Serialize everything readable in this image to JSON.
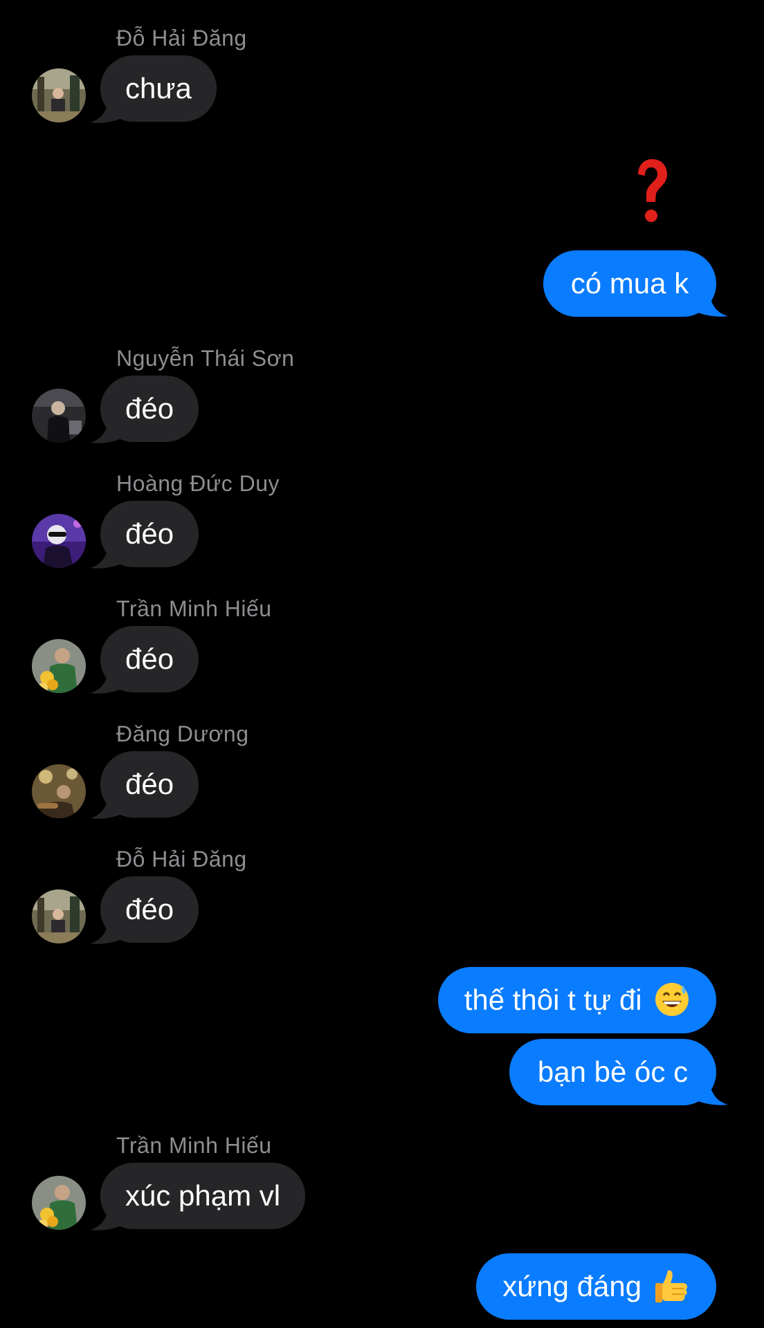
{
  "colors": {
    "background": "#000000",
    "incoming_bubble": "#262628",
    "outgoing_bubble": "#0a7cff",
    "sender_name": "#8e8e93",
    "reaction": "#e0201b"
  },
  "messages": [
    {
      "type": "incoming",
      "sender": "Đỗ Hải Đăng",
      "text": "chưa",
      "avatar": "avatar-do-hai-dang"
    },
    {
      "type": "outgoing",
      "text": "có mua k",
      "reaction": "red-question-mark-icon"
    },
    {
      "type": "incoming",
      "sender": "Nguyễn Thái Sơn",
      "text": "đéo",
      "avatar": "avatar-nguyen-thai-son"
    },
    {
      "type": "incoming",
      "sender": "Hoàng Đức Duy",
      "text": "đéo",
      "avatar": "avatar-hoang-duc-duy"
    },
    {
      "type": "incoming",
      "sender": "Trần Minh Hiếu",
      "text": "đéo",
      "avatar": "avatar-tran-minh-hieu"
    },
    {
      "type": "incoming",
      "sender": "Đăng Dương",
      "text": "đéo",
      "avatar": "avatar-dang-duong"
    },
    {
      "type": "incoming",
      "sender": "Đỗ Hải Đăng",
      "text": "đéo",
      "avatar": "avatar-do-hai-dang"
    },
    {
      "type": "outgoing",
      "text": "thế thôi t tự đi",
      "emoji": "grinning-sweat-emoji-icon"
    },
    {
      "type": "outgoing",
      "text": "bạn bè óc c"
    },
    {
      "type": "incoming",
      "sender": "Trần Minh Hiếu",
      "text": "xúc phạm vl",
      "avatar": "avatar-tran-minh-hieu"
    },
    {
      "type": "outgoing",
      "text": "xứng đáng",
      "emoji": "thumbs-up-emoji-icon"
    }
  ]
}
